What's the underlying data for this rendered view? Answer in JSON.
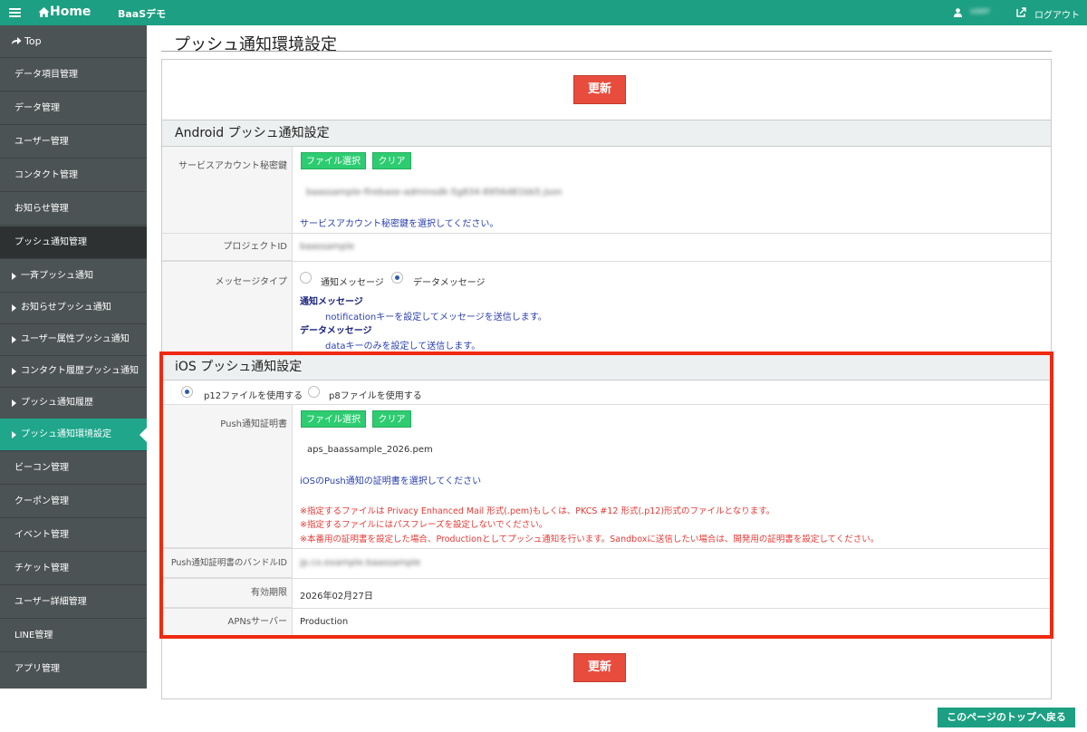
{
  "header": {
    "home_label": "Home",
    "app_name": "BaaSデモ",
    "user_name": "user",
    "logout_label": "ログアウト"
  },
  "sidebar": {
    "top_label": "Top",
    "items": [
      "データ項目管理",
      "データ管理",
      "ユーザー管理",
      "コンタクト管理",
      "お知らせ管理",
      "プッシュ通知管理",
      "一斉プッシュ通知",
      "お知らせプッシュ通知",
      "ユーザー属性プッシュ通知",
      "コンタクト履歴プッシュ通知",
      "プッシュ通知履歴",
      "プッシュ通知環境設定",
      "ビーコン管理",
      "クーポン管理",
      "イベント管理",
      "チケット管理",
      "ユーザー詳細管理",
      "LINE管理",
      "アプリ管理"
    ]
  },
  "page": {
    "title": "プッシュ通知環境設定",
    "update_label": "更新",
    "back_to_top_label": "このページのトップへ戻る"
  },
  "android": {
    "section_title": "Android プッシュ通知設定",
    "service_key_label": "サービスアカウント秘密鍵",
    "file_select_label": "ファイル選択",
    "clear_label": "クリア",
    "service_key_filename": "baassample-firebase-adminsdk-5g834-8956d81bb5.json",
    "service_key_help": "サービスアカウント秘密鍵を選択してください。",
    "project_id_label": "プロジェクトID",
    "project_id_value": "baassample",
    "message_type_label": "メッセージタイプ",
    "option_notification": "通知メッセージ",
    "option_data": "データメッセージ",
    "selected_option": "データメッセージ",
    "notification_heading": "通知メッセージ",
    "notification_desc": "notificationキーを設定してメッセージを送信します。",
    "data_heading": "データメッセージ",
    "data_desc": "dataキーのみを設定して送信します。"
  },
  "ios": {
    "section_title": "iOS プッシュ通知設定",
    "option_p12": "p12ファイルを使用する",
    "option_p8": "p8ファイルを使用する",
    "selected_option": "p12ファイルを使用する",
    "cert_label": "Push通知証明書",
    "file_select_label": "ファイル選択",
    "clear_label": "クリア",
    "cert_filename": "aps_baassample_2026.pem",
    "cert_help": "iOSのPush通知の証明書を選択してください",
    "notes": [
      "※指定するファイルは Privacy Enhanced Mail 形式(.pem)もしくは、PKCS #12 形式(.p12)形式のファイルとなります。",
      "※指定するファイルにはパスフレーズを設定しないでください。",
      "※本番用の証明書を設定した場合、Productionとしてプッシュ通知を行います。Sandboxに送信したい場合は、開発用の証明書を設定してください。"
    ],
    "bundle_id_label": "Push通知証明書のバンドルID",
    "bundle_id_value": "jp.co.example.baassample",
    "expiry_label": "有効期限",
    "expiry_value": "2026年02月27日",
    "apns_label": "APNsサーバー",
    "apns_value": "Production"
  },
  "colors": {
    "brand": "#1c9f82",
    "sidebar": "#4c5354",
    "update_button": "#e84c3d",
    "file_button": "#2ecc71",
    "highlight": "#ee2a11",
    "note_red": "#e53935"
  }
}
